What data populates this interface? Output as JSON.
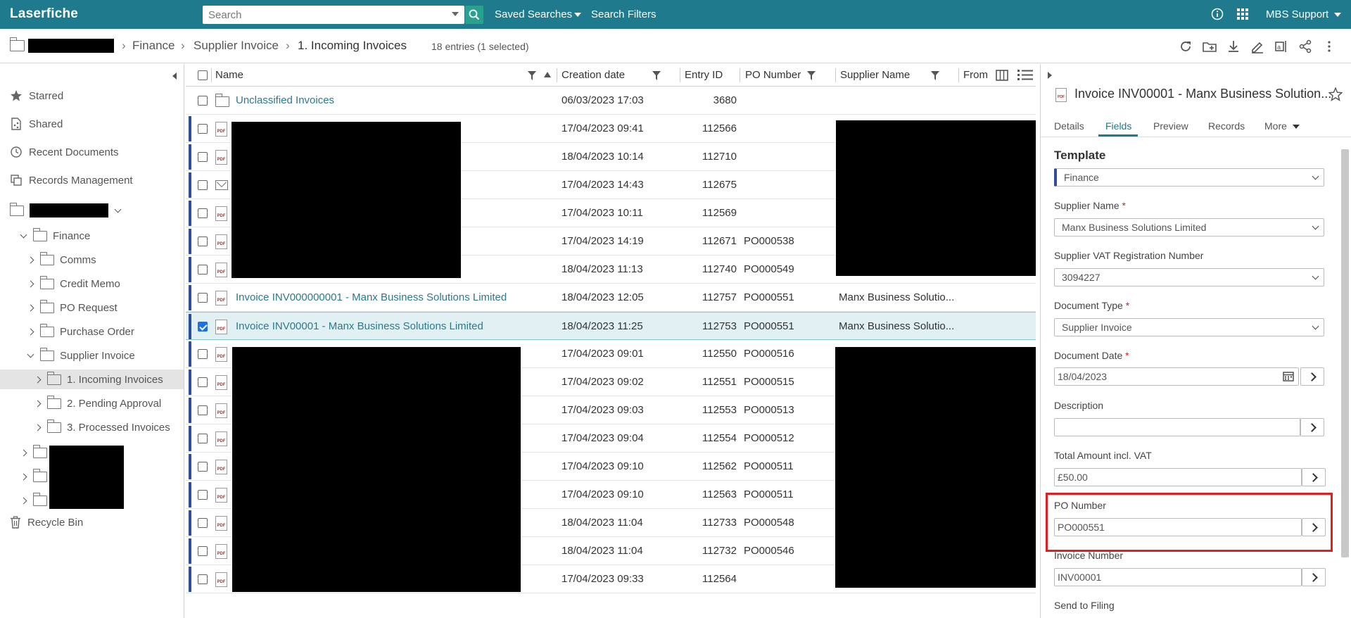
{
  "app": {
    "logo": "Laserfiche"
  },
  "topbar": {
    "search_placeholder": "Search",
    "saved_searches": "Saved Searches",
    "search_filters": "Search Filters",
    "user": "MBS Support"
  },
  "breadcrumb": {
    "items": [
      "Finance",
      "Supplier Invoice",
      "1. Incoming Invoices"
    ],
    "entries_info": "18 entries (1 selected)"
  },
  "leftnav": {
    "starred": "Starred",
    "shared": "Shared",
    "recent": "Recent Documents",
    "records": "Records Management",
    "recycle": "Recycle Bin",
    "tree": {
      "finance": "Finance",
      "comms": "Comms",
      "credit_memo": "Credit Memo",
      "po_request": "PO Request",
      "purchase_order": "Purchase Order",
      "supplier_invoice": "Supplier Invoice",
      "incoming": "1. Incoming Invoices",
      "pending": "2. Pending Approval",
      "processed": "3. Processed Invoices"
    }
  },
  "grid": {
    "columns": {
      "name": "Name",
      "created": "Creation date",
      "entry_id": "Entry ID",
      "po": "PO Number",
      "supplier": "Supplier Name",
      "from": "From"
    },
    "rows": [
      {
        "name": "Unclassified Invoices",
        "date": "06/03/2023 17:03",
        "id": "3680",
        "po": "",
        "supplier": ""
      },
      {
        "name": "",
        "date": "17/04/2023 09:41",
        "id": "112566",
        "po": "",
        "supplier": ""
      },
      {
        "name": "",
        "date": "18/04/2023 10:14",
        "id": "112710",
        "po": "",
        "supplier": ""
      },
      {
        "name": "",
        "date": "17/04/2023 14:43",
        "id": "112675",
        "po": "",
        "supplier": ""
      },
      {
        "name": "",
        "date": "17/04/2023 10:11",
        "id": "112569",
        "po": "",
        "supplier": ""
      },
      {
        "name": "",
        "date": "17/04/2023 14:19",
        "id": "112671",
        "po": "PO000538",
        "supplier": ""
      },
      {
        "name": "",
        "date": "18/04/2023 11:13",
        "id": "112740",
        "po": "PO000549",
        "supplier": ""
      },
      {
        "name": "Invoice INV000000001 - Manx Business Solutions Limited",
        "date": "18/04/2023 12:05",
        "id": "112757",
        "po": "PO000551",
        "supplier": "Manx Business Solutio..."
      },
      {
        "name": "Invoice INV00001 - Manx Business Solutions Limited",
        "date": "18/04/2023 11:25",
        "id": "112753",
        "po": "PO000551",
        "supplier": "Manx Business Solutio..."
      },
      {
        "name": "",
        "date": "17/04/2023 09:01",
        "id": "112550",
        "po": "PO000516",
        "supplier": ""
      },
      {
        "name": "",
        "date": "17/04/2023 09:02",
        "id": "112551",
        "po": "PO000515",
        "supplier": ""
      },
      {
        "name": "",
        "date": "17/04/2023 09:03",
        "id": "112553",
        "po": "PO000513",
        "supplier": ""
      },
      {
        "name": "",
        "date": "17/04/2023 09:04",
        "id": "112554",
        "po": "PO000512",
        "supplier": ""
      },
      {
        "name": "",
        "date": "17/04/2023 09:10",
        "id": "112562",
        "po": "PO000511",
        "supplier": ""
      },
      {
        "name": "",
        "date": "17/04/2023 09:10",
        "id": "112563",
        "po": "PO000511",
        "supplier": ""
      },
      {
        "name": "",
        "date": "18/04/2023 11:04",
        "id": "112733",
        "po": "PO000548",
        "supplier": ""
      },
      {
        "name": "",
        "date": "18/04/2023 11:04",
        "id": "112732",
        "po": "PO000546",
        "supplier": ""
      },
      {
        "name": "",
        "date": "17/04/2023 09:33",
        "id": "112564",
        "po": "",
        "supplier": ""
      }
    ]
  },
  "panel": {
    "title": "Invoice INV00001 - Manx Business Solution...",
    "tabs": [
      "Details",
      "Fields",
      "Preview",
      "Records",
      "More"
    ],
    "template_label": "Template",
    "template_value": "Finance",
    "supplier_name_label": "Supplier Name",
    "supplier_name_value": "Manx Business Solutions Limited",
    "vat_label": "Supplier VAT Registration Number",
    "vat_value": "3094227",
    "doc_type_label": "Document Type",
    "doc_type_value": "Supplier Invoice",
    "doc_date_label": "Document Date",
    "doc_date_value": "18/04/2023",
    "description_label": "Description",
    "description_value": "",
    "total_label": "Total Amount incl. VAT",
    "total_value": "£50.00",
    "po_label": "PO Number",
    "po_value": "PO000551",
    "invoice_label": "Invoice Number",
    "invoice_value": "INV00001",
    "send_label": "Send to Filing",
    "required_mark": "*"
  }
}
